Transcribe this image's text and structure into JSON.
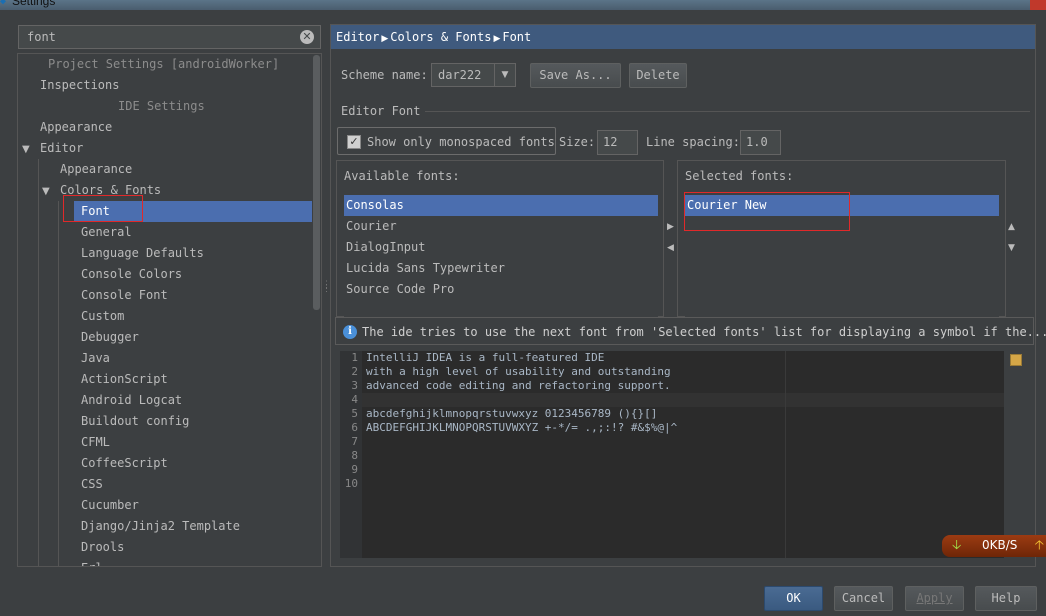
{
  "window": {
    "title": "Settings"
  },
  "search": {
    "value": "font"
  },
  "tree": {
    "sections": {
      "project": "Project Settings [androidWorker]",
      "ide": "IDE Settings"
    },
    "items": {
      "inspections": "Inspections",
      "appearance": "Appearance",
      "editor": "Editor",
      "editor_appearance": "Appearance",
      "colors_fonts": "Colors & Fonts",
      "font": "Font",
      "general": "General",
      "language_defaults": "Language Defaults",
      "console_colors": "Console Colors",
      "console_font": "Console Font",
      "custom": "Custom",
      "debugger": "Debugger",
      "java": "Java",
      "actionscript": "ActionScript",
      "android_logcat": "Android Logcat",
      "buildout_config": "Buildout config",
      "cfml": "CFML",
      "coffeescript": "CoffeeScript",
      "css": "CSS",
      "cucumber": "Cucumber",
      "django": "Django/Jinja2 Template",
      "drools": "Drools",
      "cut": "Erl"
    }
  },
  "breadcrumb": [
    "Editor",
    "Colors & Fonts",
    "Font"
  ],
  "scheme": {
    "label": "Scheme name:",
    "value": "dar222",
    "save_as": "Save As...",
    "delete": "Delete"
  },
  "editor_font": {
    "group_title": "Editor Font",
    "mono_only": "Show only monospaced fonts",
    "mono_checked": true,
    "size_label": "Size:",
    "size_value": "12",
    "spacing_label": "Line spacing:",
    "spacing_value": "1.0"
  },
  "available_fonts": {
    "header": "Available fonts:",
    "items": [
      "Consolas",
      "Courier",
      "DialogInput",
      "Lucida Sans Typewriter",
      "Source Code Pro"
    ],
    "selected_index": 0
  },
  "selected_fonts": {
    "header": "Selected fonts:",
    "items": [
      "Courier New"
    ],
    "selected_index": 0
  },
  "info": {
    "text": "The ide tries to use the next font from 'Selected fonts' list for displaying a symbol if the..."
  },
  "preview": {
    "line_numbers": [
      "1",
      "2",
      "3",
      "4",
      "5",
      "6",
      "7",
      "8",
      "9",
      "10"
    ],
    "lines": [
      "IntelliJ IDEA is a full-featured IDE",
      "with a high level of usability and outstanding",
      "advanced code editing and refactoring support.",
      "",
      "abcdefghijklmnopqrstuvwxyz 0123456789 (){}[]",
      "ABCDEFGHIJKLMNOPQRSTUVWXYZ +-*/= .,;:!? #&$%@|^"
    ]
  },
  "netspeed": {
    "value": "0KB/S"
  },
  "buttons": {
    "ok": "OK",
    "cancel": "Cancel",
    "apply": "Apply",
    "help": "Help"
  },
  "colors": {
    "selection": "#4b6eaf",
    "background": "#3c3f41",
    "highlight_box": "#e0292a"
  }
}
